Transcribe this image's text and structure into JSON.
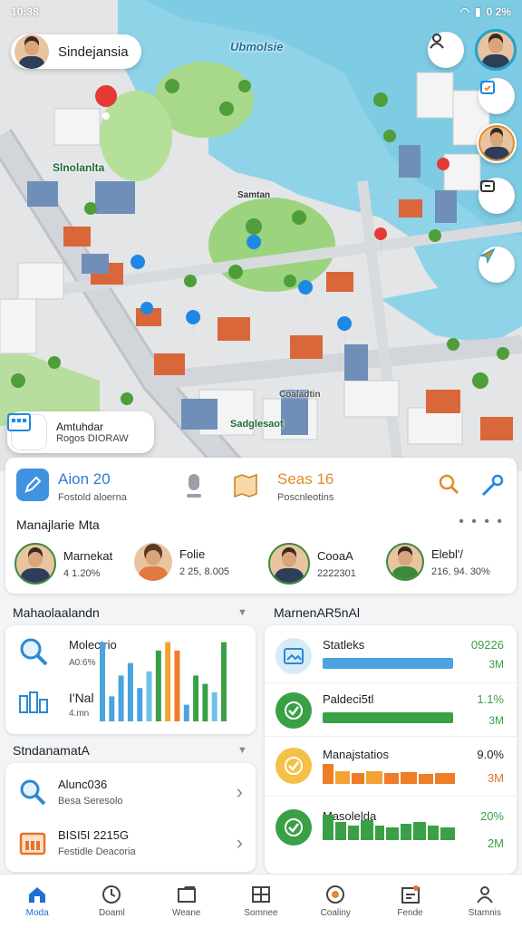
{
  "status_bar": {
    "time": "10:38",
    "battery": "0 2%"
  },
  "map": {
    "user_name": "Sindejansia",
    "label_water": "Ubmolsie",
    "label_park": "Slnolanlta",
    "label_green": "Samtan",
    "label_district": "Sadglesaot",
    "label_poi": "Coaladtin",
    "poi_chip": {
      "title": "Amtuhdar",
      "subtitle": "Rogos DIORAW"
    }
  },
  "summary": {
    "stat1": {
      "value": "Aion 20",
      "label": "Fostold aloerna"
    },
    "stat2": {
      "value": "Seas 16",
      "label": "Poscnleotins"
    },
    "people_title": "Manajlarie Mta",
    "more": "• • • •",
    "people": [
      {
        "name": "Marnekat",
        "value": "4 1.20%"
      },
      {
        "name": "Folie",
        "value": "2 25, 8.005"
      },
      {
        "name": "CooaA",
        "value": "2222301"
      },
      {
        "name": "Elebl'/",
        "value": "216, 94. 30%"
      }
    ]
  },
  "left_panel": {
    "chart_section_title": "Mahaolaalandn",
    "chart_rows": [
      {
        "label": "Molectrio",
        "sub": "A0:6%"
      },
      {
        "label": "I'Nal",
        "sub": "4.mn"
      }
    ],
    "list_section_title": "StndanamatA",
    "list_items": [
      {
        "title": "Alunc036",
        "subtitle": "Besa Seresolo"
      },
      {
        "title": "BISI5I 2215G",
        "subtitle": "Festidle Deacoria"
      }
    ]
  },
  "right_panel": {
    "section_title": "MarnenAR5nAl",
    "rows": [
      {
        "label": "Statleks",
        "pct": "09226",
        "sub": "3M",
        "color": "#4aa3df",
        "fill": 0.96
      },
      {
        "label": "Paldeci5tl",
        "pct": "1.1%",
        "sub": "3M",
        "color": "#3aa046",
        "fill": 0.96
      },
      {
        "label": "Manajstatios",
        "pct": "9.0%",
        "sub": "3M",
        "color": "#ee7d2a",
        "fill": 0.98
      },
      {
        "label": "Masolelda",
        "pct": "20%",
        "sub": "2M",
        "color": "#3aa046",
        "fill": 0.98
      }
    ]
  },
  "tabs": [
    {
      "label": "Moda",
      "icon": "home-icon"
    },
    {
      "label": "Doaml",
      "icon": "clock-icon"
    },
    {
      "label": "Weane",
      "icon": "folder-icon"
    },
    {
      "label": "Somnee",
      "icon": "grid-icon"
    },
    {
      "label": "Coaliny",
      "icon": "target-icon"
    },
    {
      "label": "Fende",
      "icon": "calendar-icon"
    },
    {
      "label": "Stamnis",
      "icon": "person-icon"
    }
  ],
  "chart_data": {
    "type": "bar",
    "categories": [
      "1",
      "2",
      "3",
      "4",
      "5",
      "6",
      "7",
      "8",
      "9",
      "10",
      "11",
      "12",
      "13",
      "14"
    ],
    "series": [
      {
        "values": [
          0.95,
          0.3,
          0.55,
          0.7,
          0.4,
          0.6,
          0.85,
          0.95,
          0.85,
          0.2,
          0.55,
          0.45,
          0.35,
          0.95
        ]
      }
    ],
    "colors": [
      "#4aa3df",
      "#4aa3df",
      "#4aa3df",
      "#4aa3df",
      "#4aa3df",
      "#6fc2e8",
      "#3aa046",
      "#f2a334",
      "#ee7d2a",
      "#4aa3df",
      "#3aa046",
      "#3aa046",
      "#6fc2e8",
      "#3aa046"
    ],
    "ylim": [
      0,
      1
    ]
  }
}
